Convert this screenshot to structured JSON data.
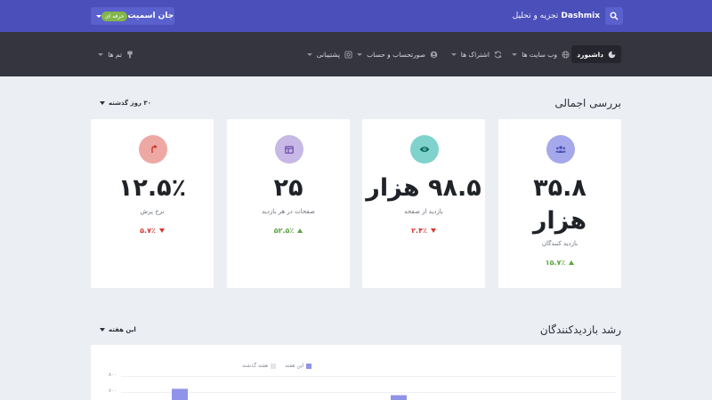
{
  "header": {
    "brand_name": "Dashmix",
    "brand_sub": "تجزیه و تحلیل",
    "user_name": "جان اسمیت",
    "user_badge": "حرفه ای",
    "search_icon": "search-icon"
  },
  "nav": {
    "items": [
      {
        "label": "داشبورد",
        "icon": "chart-pie-icon",
        "active": true
      },
      {
        "label": "وب سایت ها",
        "icon": "globe-icon"
      },
      {
        "label": "اشتراک ها",
        "icon": "sync-icon"
      },
      {
        "label": "صورتحساب و حساب",
        "icon": "user-circle-icon"
      },
      {
        "label": "پشتیبانی",
        "icon": "life-ring-icon"
      },
      {
        "label": "تم ها",
        "icon": "brush-icon"
      }
    ]
  },
  "overview": {
    "title": "بررسی اجمالی",
    "range": "۳۰ روز گذشته",
    "cards": [
      {
        "value": "۳۵.۸",
        "value2": "هزار",
        "label": "بازدید کنندگان",
        "change": "۱۵.۷٪",
        "trend": "up",
        "icon": "users-icon",
        "color": "#a5a8ea",
        "icon_color": "#4a4fb9"
      },
      {
        "value": "۹۸.۵ هزار",
        "label": "بازدید از صفحه",
        "change": "۲.۴٪",
        "trend": "down",
        "icon": "eye-icon",
        "color": "#7fd3cc",
        "icon_color": "#0d6b62"
      },
      {
        "value": "۲۵",
        "label": "صفحات در هر بازدید",
        "change": "۵۲.۵٪",
        "trend": "up",
        "icon": "window-icon",
        "color": "#c8b8e6",
        "icon_color": "#6a49a8"
      },
      {
        "value": "۱۲.۵٪",
        "label": "نرخ پرش",
        "change": "۵.۷٪",
        "trend": "down",
        "icon": "external-link-icon",
        "color": "#eea8a4",
        "icon_color": "#c8302a"
      }
    ]
  },
  "growth": {
    "title": "رشد بازدیدکنندگان",
    "range": "این هفته",
    "legend": [
      {
        "label": "این هفته",
        "color": "#8f94e8"
      },
      {
        "label": "هفته گذشته",
        "color": "#e3e5ea"
      }
    ],
    "yticks": [
      "۸۰۰",
      "۷۰۰"
    ]
  },
  "chart_data": {
    "type": "bar",
    "series": [
      {
        "name": "این هفته",
        "values": [
          720,
          680
        ]
      },
      {
        "name": "هفته گذشته",
        "values": []
      }
    ],
    "ylim": [
      0,
      800
    ],
    "yticks": [
      "۸۰۰",
      "۷۰۰"
    ]
  }
}
